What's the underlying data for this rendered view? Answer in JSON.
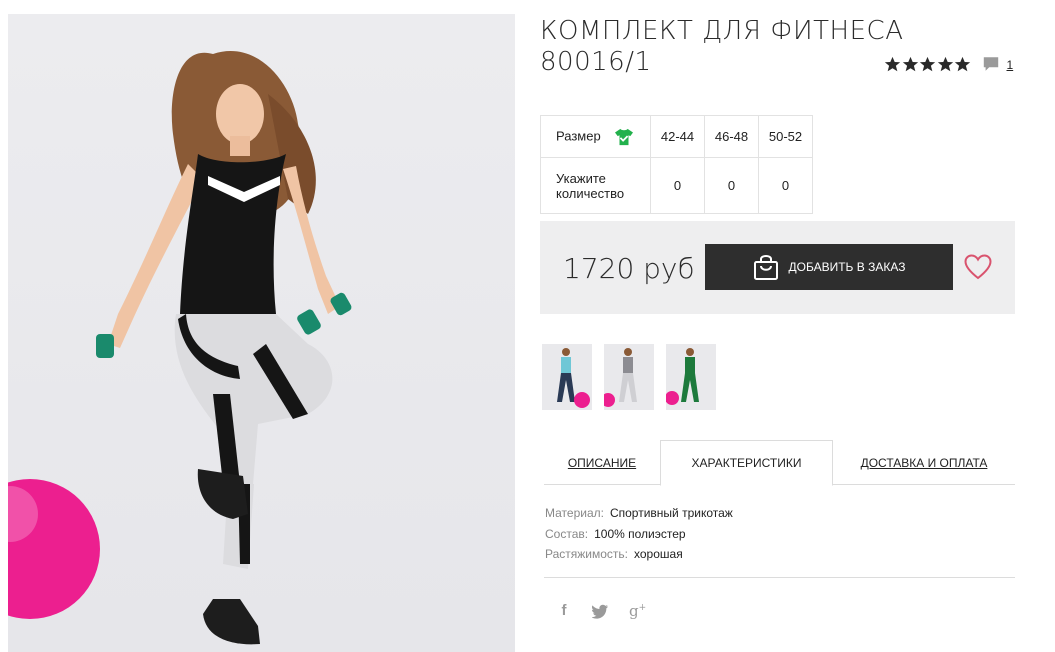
{
  "product": {
    "title": "КОМПЛЕКТ ДЛЯ ФИТНЕСА 80016/1",
    "rating_stars": 5,
    "review_count": "1"
  },
  "sizes": {
    "size_label": "Размер",
    "qty_label": "Укажите количество",
    "columns": [
      "42-44",
      "46-48",
      "50-52"
    ],
    "quantities": [
      "0",
      "0",
      "0"
    ]
  },
  "buy": {
    "price": "1720 руб",
    "add_label": "ДОБАВИТЬ В ЗАКАЗ"
  },
  "tabs": [
    {
      "label": "ОПИСАНИЕ"
    },
    {
      "label": "ХАРАКТЕРИСТИКИ"
    },
    {
      "label": "ДОСТАВКА И ОПЛАТА"
    }
  ],
  "specs": [
    {
      "key": "Материал:",
      "value": "Спортивный трикотаж"
    },
    {
      "key": "Состав:",
      "value": "100% полиэстер"
    },
    {
      "key": "Растяжимость:",
      "value": "хорошая"
    }
  ],
  "colors": {
    "accent_heart": "#d9536e",
    "button_bg": "#2e2e2e",
    "size_icon": "#22b14c"
  },
  "icons": {
    "share": [
      "facebook-icon",
      "twitter-icon",
      "google-plus-icon"
    ]
  }
}
